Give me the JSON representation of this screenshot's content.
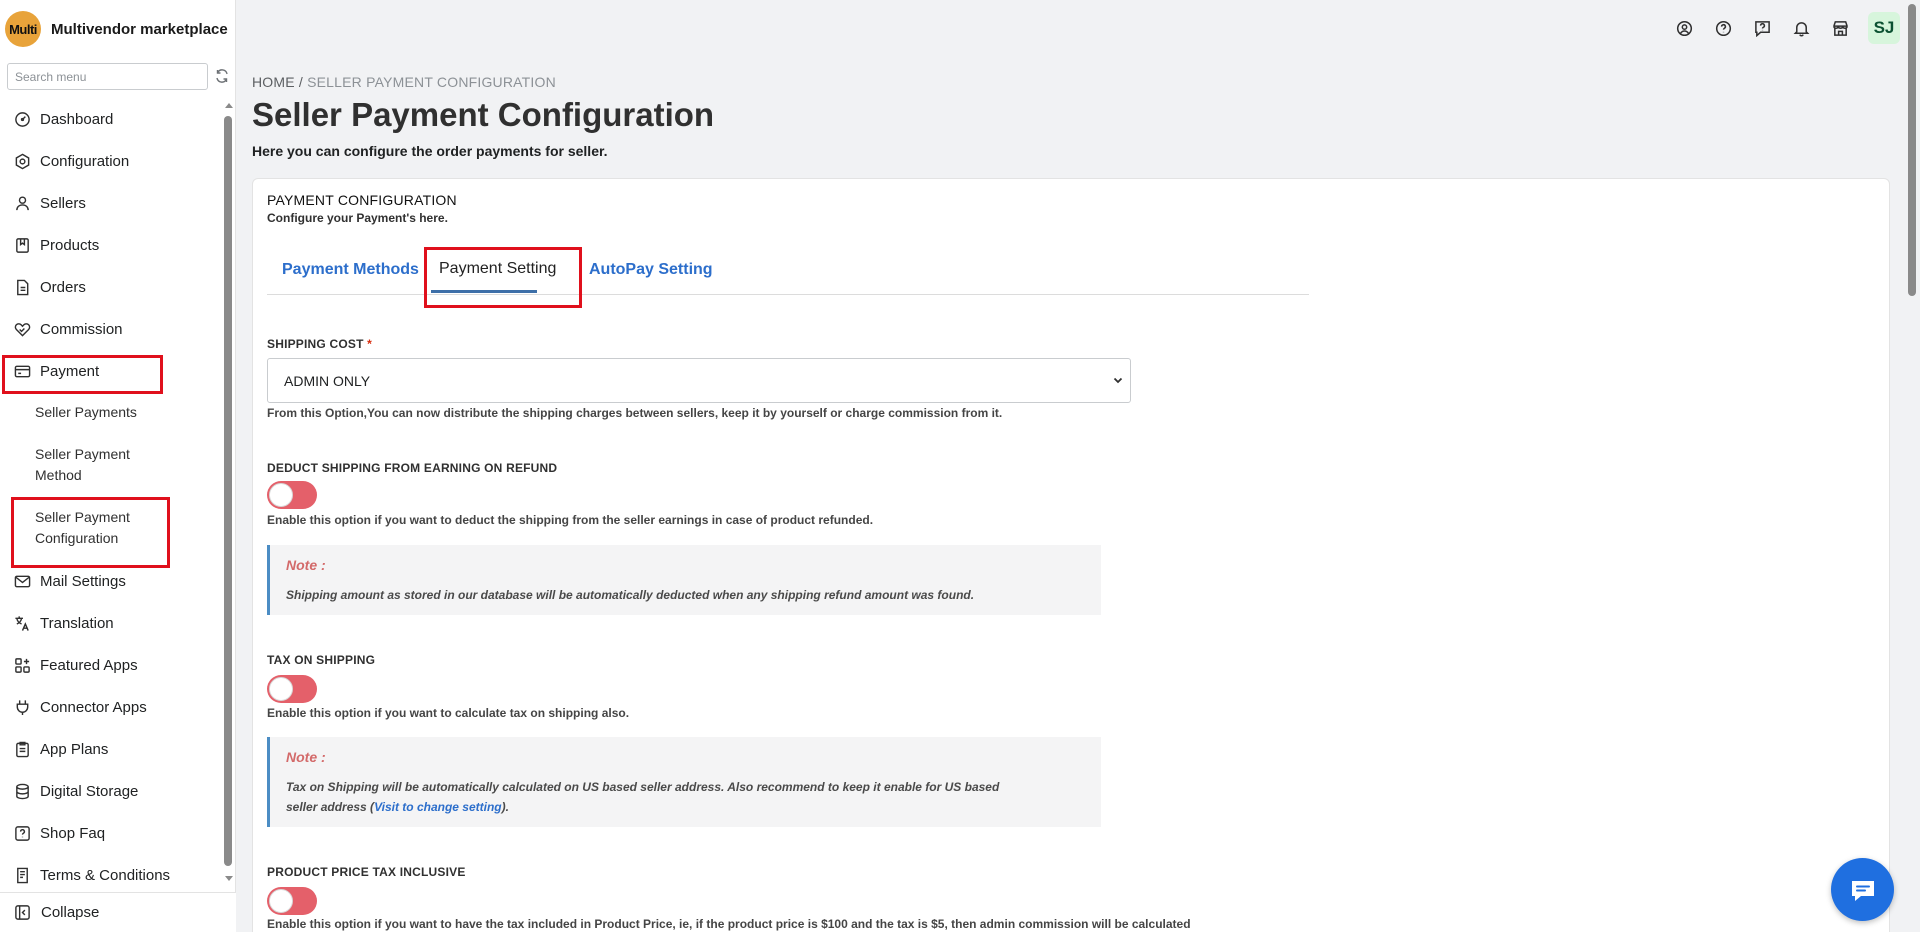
{
  "app": {
    "logo_text": "Multi",
    "name": "Multivendor marketplace"
  },
  "sidebar": {
    "search_placeholder": "Search menu",
    "items": [
      {
        "label": "Dashboard",
        "icon": "dashboard-icon"
      },
      {
        "label": "Configuration",
        "icon": "gear-icon"
      },
      {
        "label": "Sellers",
        "icon": "person-icon"
      },
      {
        "label": "Products",
        "icon": "book-icon"
      },
      {
        "label": "Orders",
        "icon": "document-icon"
      },
      {
        "label": "Commission",
        "icon": "handshake-icon"
      },
      {
        "label": "Payment",
        "icon": "card-icon"
      },
      {
        "label": "Mail Settings",
        "icon": "mail-icon"
      },
      {
        "label": "Translation",
        "icon": "translate-icon"
      },
      {
        "label": "Featured Apps",
        "icon": "apps-icon"
      },
      {
        "label": "Connector Apps",
        "icon": "plug-icon"
      },
      {
        "label": "App Plans",
        "icon": "clipboard-icon"
      },
      {
        "label": "Digital Storage",
        "icon": "database-icon"
      },
      {
        "label": "Shop Faq",
        "icon": "question-icon"
      },
      {
        "label": "Terms & Conditions",
        "icon": "terms-icon"
      }
    ],
    "payment_sub": [
      {
        "line1": "Seller Payments",
        "line2": ""
      },
      {
        "line1": "Seller Payment",
        "line2": "Method"
      },
      {
        "line1": "Seller Payment",
        "line2": "Configuration"
      }
    ],
    "collapse_label": "Collapse"
  },
  "topbar": {
    "icons": [
      "account-icon",
      "help-icon",
      "chat-help-icon",
      "bell-icon",
      "store-icon"
    ],
    "avatar_initials": "SJ"
  },
  "page": {
    "breadcrumb_home": "HOME",
    "breadcrumb_sep": " / ",
    "breadcrumb_current": "SELLER PAYMENT CONFIGURATION",
    "title": "Seller Payment Configuration",
    "subtitle": "Here you can configure the order payments for seller."
  },
  "card": {
    "header": "PAYMENT CONFIGURATION",
    "subheader": "Configure your Payment's here.",
    "tabs": [
      "Payment Methods",
      "Payment Setting",
      "AutoPay Setting"
    ],
    "active_tab": "Payment Setting",
    "shipping_cost": {
      "label": "SHIPPING COST",
      "required_mark": "*",
      "selected": "ADMIN ONLY",
      "help": "From this Option,You can now distribute the shipping charges between sellers, keep it by yourself or charge commission from it."
    },
    "deduct_shipping": {
      "label": "DEDUCT SHIPPING FROM EARNING ON REFUND",
      "enabled": false,
      "help": "Enable this option if you want to deduct the shipping from the seller earnings in case of product refunded.",
      "note_title": "Note :",
      "note_text": "Shipping amount as stored in our database will be automatically deducted when any shipping refund amount was found."
    },
    "tax_on_shipping": {
      "label": "TAX ON SHIPPING",
      "enabled": false,
      "help": "Enable this option if you want to calculate tax on shipping also.",
      "note_title": "Note :",
      "note_text_1": "Tax on Shipping will be automatically calculated on US based seller address. Also recommend to keep it enable for US based",
      "note_text_2a": "seller address (",
      "note_link": "Visit to change setting",
      "note_text_2b": ")."
    },
    "price_tax_inclusive": {
      "label": "PRODUCT PRICE TAX INCLUSIVE",
      "enabled": false,
      "help": "Enable this option if you want to have the tax included in Product Price, ie, if the product price is $100 and the tax is $5, then admin commission will be calculated"
    }
  },
  "colors": {
    "accent": "#2c6ecb",
    "toggle_off": "#e4606a",
    "highlight": "#e0101c",
    "note_border": "#4c8dc4"
  }
}
